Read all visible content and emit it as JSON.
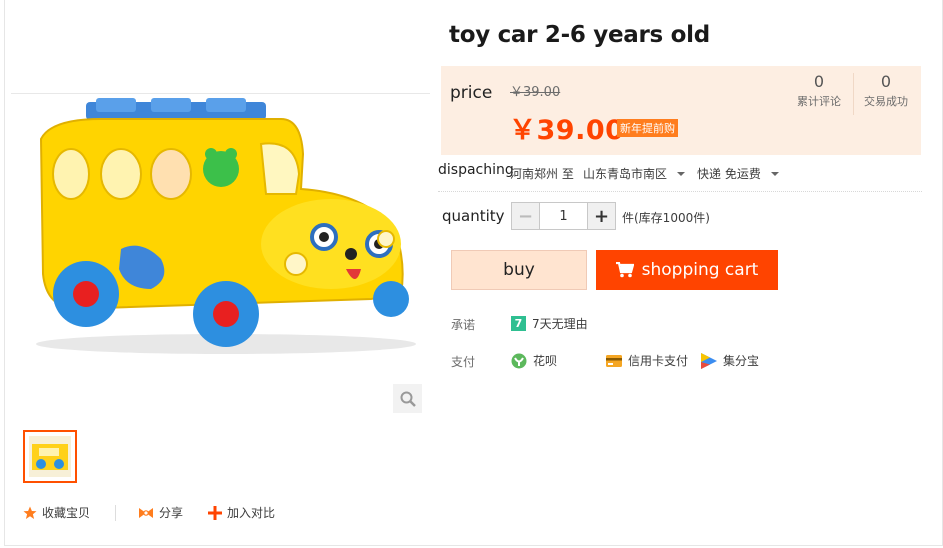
{
  "product": {
    "title": "toy car  2-6 years old"
  },
  "price": {
    "label": "price",
    "original": "￥39.00",
    "current": "￥39.00",
    "promo_tag": "新年提前购"
  },
  "stats": {
    "reviews": {
      "count": "0",
      "label": "累计评论"
    },
    "sales": {
      "count": "0",
      "label": "交易成功"
    }
  },
  "dispatch": {
    "label": "dispaching",
    "from": "河南郑州 至",
    "to": "山东青岛市南区",
    "shipping": "快递 免运费"
  },
  "quantity": {
    "label": "quantity",
    "value": "1",
    "minus": "−",
    "plus": "+",
    "stock": "件(库存1000件)"
  },
  "buttons": {
    "buy": "buy",
    "cart": "shopping cart"
  },
  "promise": {
    "label": "承诺",
    "icon_text": "7",
    "text": "7天无理由"
  },
  "payment": {
    "label": "支付",
    "methods": [
      "花呗",
      "信用卡支付",
      "集分宝"
    ]
  },
  "actions": {
    "favorite": "收藏宝贝",
    "share": "分享",
    "compare": "加入对比"
  },
  "colors": {
    "accent": "#ff4400",
    "price_bg": "#fdeee2",
    "promo": "#ff7d1e"
  }
}
